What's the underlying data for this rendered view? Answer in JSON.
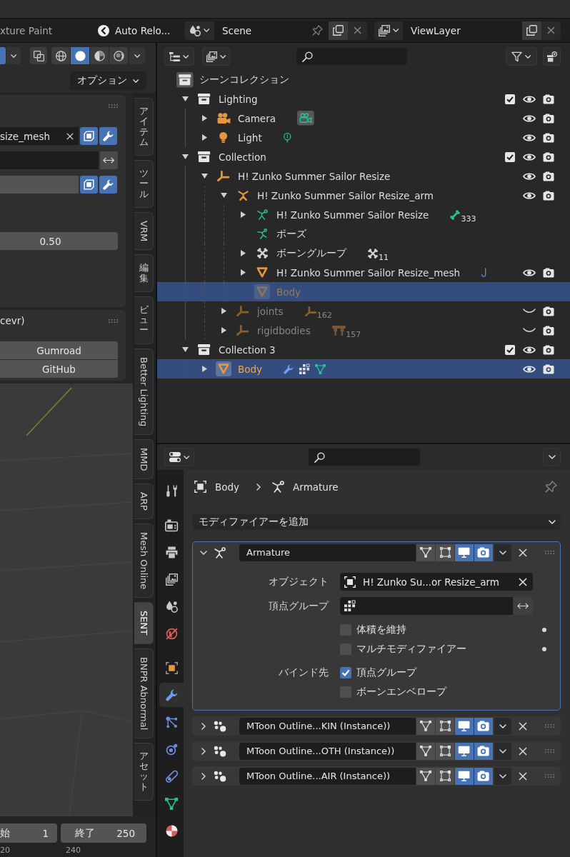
{
  "top_bar": {
    "mode_tab": "xture Paint",
    "auto_reload": "Auto Relo...",
    "scene": "Scene",
    "view_layer": "ViewLayer"
  },
  "viewport": {
    "header_toggle": {
      "on": true
    },
    "xray": {
      "on": false
    },
    "shading": [
      {
        "kind": "wireframe",
        "selected": false
      },
      {
        "kind": "solid",
        "selected": true
      },
      {
        "kind": "material",
        "selected": false
      },
      {
        "kind": "rendered",
        "selected": false
      }
    ],
    "options": "オプション",
    "panels": [
      {
        "rows": [
          {
            "kind": "object",
            "value": "size_mesh",
            "toggles": [
              {
                "kind": "shape",
                "on": true
              },
              {
                "kind": "modifier",
                "on": true
              }
            ]
          },
          {
            "kind": "group"
          },
          {
            "kind": "blank",
            "toggles": [
              {
                "kind": "shape",
                "on": true
              },
              {
                "kind": "modifier",
                "on": true
              }
            ]
          },
          {
            "kind": "number",
            "value": "0.50"
          }
        ]
      },
      {
        "title": "cevr)",
        "rows": [
          {
            "kind": "button",
            "value": "Gumroad"
          },
          {
            "kind": "button",
            "value": "GitHub"
          }
        ]
      }
    ],
    "tabs": [
      {
        "label": "アイテム",
        "selected": false
      },
      {
        "label": "ツール",
        "selected": false
      },
      {
        "label": "VRM",
        "selected": false
      },
      {
        "label": "編集",
        "selected": false
      },
      {
        "label": "ビュー",
        "selected": false
      },
      {
        "label": "Better Lighting",
        "selected": false
      },
      {
        "label": "MMD",
        "selected": false
      },
      {
        "label": "ARP",
        "selected": false
      },
      {
        "label": "Mesh Online",
        "selected": false
      },
      {
        "label": "SENT",
        "selected": true
      },
      {
        "label": "BNPR Abnormal",
        "selected": false
      },
      {
        "label": "アセット",
        "selected": false
      }
    ],
    "timeline": {
      "start_label": "始",
      "start": "1",
      "end_label": "終了",
      "end": "250",
      "ruler": [
        "20",
        "240"
      ]
    }
  },
  "outliner": {
    "tree": [
      {
        "label": "シーンコレクション",
        "kind": "scene-collection",
        "selected": false,
        "active": true,
        "dimmed": false,
        "children": [
          {
            "label": "Lighting",
            "kind": "collection",
            "expanded": true,
            "selected": false,
            "active": false,
            "dimmed": false,
            "included": true,
            "visible": true,
            "renderable": true,
            "children": [
              {
                "label": "Camera",
                "kind": "camera",
                "expanded": false,
                "selected": false,
                "active": false,
                "dimmed": false,
                "extras": [
                  {
                    "kind": "camera-data",
                    "active": true
                  }
                ],
                "visible": true,
                "renderable": true
              },
              {
                "label": "Light",
                "kind": "light",
                "expanded": false,
                "selected": false,
                "active": false,
                "dimmed": false,
                "extras": [
                  {
                    "kind": "light-data",
                    "active": false
                  }
                ],
                "visible": true,
                "renderable": true
              }
            ]
          },
          {
            "label": "Collection",
            "kind": "collection",
            "expanded": true,
            "selected": false,
            "active": false,
            "dimmed": false,
            "included": true,
            "visible": true,
            "renderable": true,
            "children": [
              {
                "label": "H! Zunko Summer Sailor Resize",
                "kind": "empty",
                "expanded": true,
                "selected": false,
                "active": false,
                "dimmed": false,
                "visible": true,
                "renderable": true,
                "children": [
                  {
                    "label": "H! Zunko Summer Sailor Resize_arm",
                    "kind": "armature",
                    "expanded": true,
                    "selected": false,
                    "active": false,
                    "dimmed": false,
                    "visible": true,
                    "renderable": true,
                    "children": [
                      {
                        "label": "H! Zunko Summer Sailor Resize",
                        "kind": "armature-data",
                        "expanded": false,
                        "selected": false,
                        "active": false,
                        "dimmed": false,
                        "extras": [
                          {
                            "kind": "bone",
                            "count": "333",
                            "active": false
                          }
                        ]
                      },
                      {
                        "label": "ポーズ",
                        "kind": "pose",
                        "selected": false,
                        "active": false,
                        "dimmed": false
                      },
                      {
                        "label": "ボーングループ",
                        "kind": "bone-group",
                        "expanded": false,
                        "selected": false,
                        "active": false,
                        "dimmed": false,
                        "extras": [
                          {
                            "kind": "bone-group",
                            "count": "11",
                            "active": false
                          }
                        ]
                      },
                      {
                        "label": "H! Zunko Summer Sailor Resize_mesh",
                        "kind": "mesh",
                        "expanded": false,
                        "selected": false,
                        "active": false,
                        "dimmed": false,
                        "extras": [
                          {
                            "kind": "hook",
                            "active": false
                          }
                        ],
                        "visible": true,
                        "renderable": true
                      },
                      {
                        "label": "Body",
                        "kind": "mesh",
                        "selected": true,
                        "active": true,
                        "dimmed": true
                      }
                    ]
                  },
                  {
                    "label": "joints",
                    "kind": "empty",
                    "expanded": false,
                    "selected": false,
                    "active": false,
                    "dimmed": true,
                    "extras": [
                      {
                        "kind": "empty",
                        "count": "162",
                        "active": false
                      }
                    ],
                    "visible": false,
                    "renderable": true
                  },
                  {
                    "label": "rigidbodies",
                    "kind": "empty",
                    "expanded": false,
                    "selected": false,
                    "active": false,
                    "dimmed": true,
                    "extras": [
                      {
                        "kind": "rigid-body",
                        "count": "157",
                        "active": false
                      }
                    ],
                    "visible": false,
                    "renderable": true
                  }
                ]
              }
            ]
          },
          {
            "label": "Collection 3",
            "kind": "collection",
            "expanded": true,
            "selected": false,
            "active": false,
            "dimmed": false,
            "included": true,
            "visible": true,
            "renderable": true,
            "children": [
              {
                "label": "Body",
                "kind": "mesh",
                "expanded": false,
                "selected": true,
                "active": true,
                "dimmed": false,
                "extras": [
                  {
                    "kind": "modifier",
                    "active": false
                  },
                  {
                    "kind": "vertex-groups",
                    "active": false
                  },
                  {
                    "kind": "mesh-data",
                    "active": false
                  }
                ],
                "visible": true,
                "renderable": true
              }
            ]
          }
        ]
      }
    ]
  },
  "properties": {
    "tabs": [
      {
        "kind": "tool",
        "selected": false
      },
      {
        "kind": "render",
        "selected": false
      },
      {
        "kind": "output",
        "selected": false
      },
      {
        "kind": "view-layer",
        "selected": false
      },
      {
        "kind": "scene",
        "selected": false
      },
      {
        "kind": "world",
        "selected": false
      },
      {
        "kind": "object",
        "selected": false
      },
      {
        "kind": "modifiers",
        "selected": true
      },
      {
        "kind": "particles",
        "selected": false
      },
      {
        "kind": "physics",
        "selected": false
      },
      {
        "kind": "constraints",
        "selected": false
      },
      {
        "kind": "data",
        "selected": false
      },
      {
        "kind": "material",
        "selected": false
      }
    ],
    "breadcrumb": [
      {
        "kind": "object",
        "label": "Body"
      },
      {
        "kind": "armature",
        "label": "Armature"
      }
    ],
    "add_modifier": "モディファイアーを追加",
    "modifiers": [
      {
        "kind": "armature",
        "name": "Armature",
        "expanded": true,
        "active": true,
        "toggles": [
          {
            "kind": "edit-mode",
            "on": false
          },
          {
            "kind": "on-cage",
            "on": false
          },
          {
            "kind": "viewport",
            "on": true
          },
          {
            "kind": "render",
            "on": true
          }
        ],
        "object": {
          "label": "オブジェクト",
          "value": "H! Zunko Su...or Resize_arm"
        },
        "vertex_group": {
          "label": "頂点グループ"
        },
        "options": [
          {
            "label": "体積を維持",
            "checked": false
          },
          {
            "label": "マルチモディファイアー",
            "checked": false
          }
        ],
        "bind_to": {
          "label": "バインド先",
          "options": [
            {
              "label": "頂点グループ",
              "checked": true
            },
            {
              "label": "ボーンエンベロープ",
              "checked": false
            }
          ]
        }
      },
      {
        "kind": "outline",
        "name": "MToon Outline...KIN (Instance))",
        "expanded": false,
        "active": false,
        "toggles": [
          {
            "kind": "edit-mode",
            "on": false
          },
          {
            "kind": "on-cage",
            "on": false
          },
          {
            "kind": "viewport",
            "on": true
          },
          {
            "kind": "render",
            "on": true
          }
        ]
      },
      {
        "kind": "outline",
        "name": "MToon Outline...OTH (Instance))",
        "expanded": false,
        "active": false,
        "toggles": [
          {
            "kind": "edit-mode",
            "on": false
          },
          {
            "kind": "on-cage",
            "on": false
          },
          {
            "kind": "viewport",
            "on": true
          },
          {
            "kind": "render",
            "on": true
          }
        ]
      },
      {
        "kind": "outline",
        "name": "MToon Outline...AIR (Instance))",
        "expanded": false,
        "active": false,
        "toggles": [
          {
            "kind": "edit-mode",
            "on": false
          },
          {
            "kind": "on-cage",
            "on": false
          },
          {
            "kind": "viewport",
            "on": true
          },
          {
            "kind": "render",
            "on": true
          }
        ]
      }
    ]
  }
}
